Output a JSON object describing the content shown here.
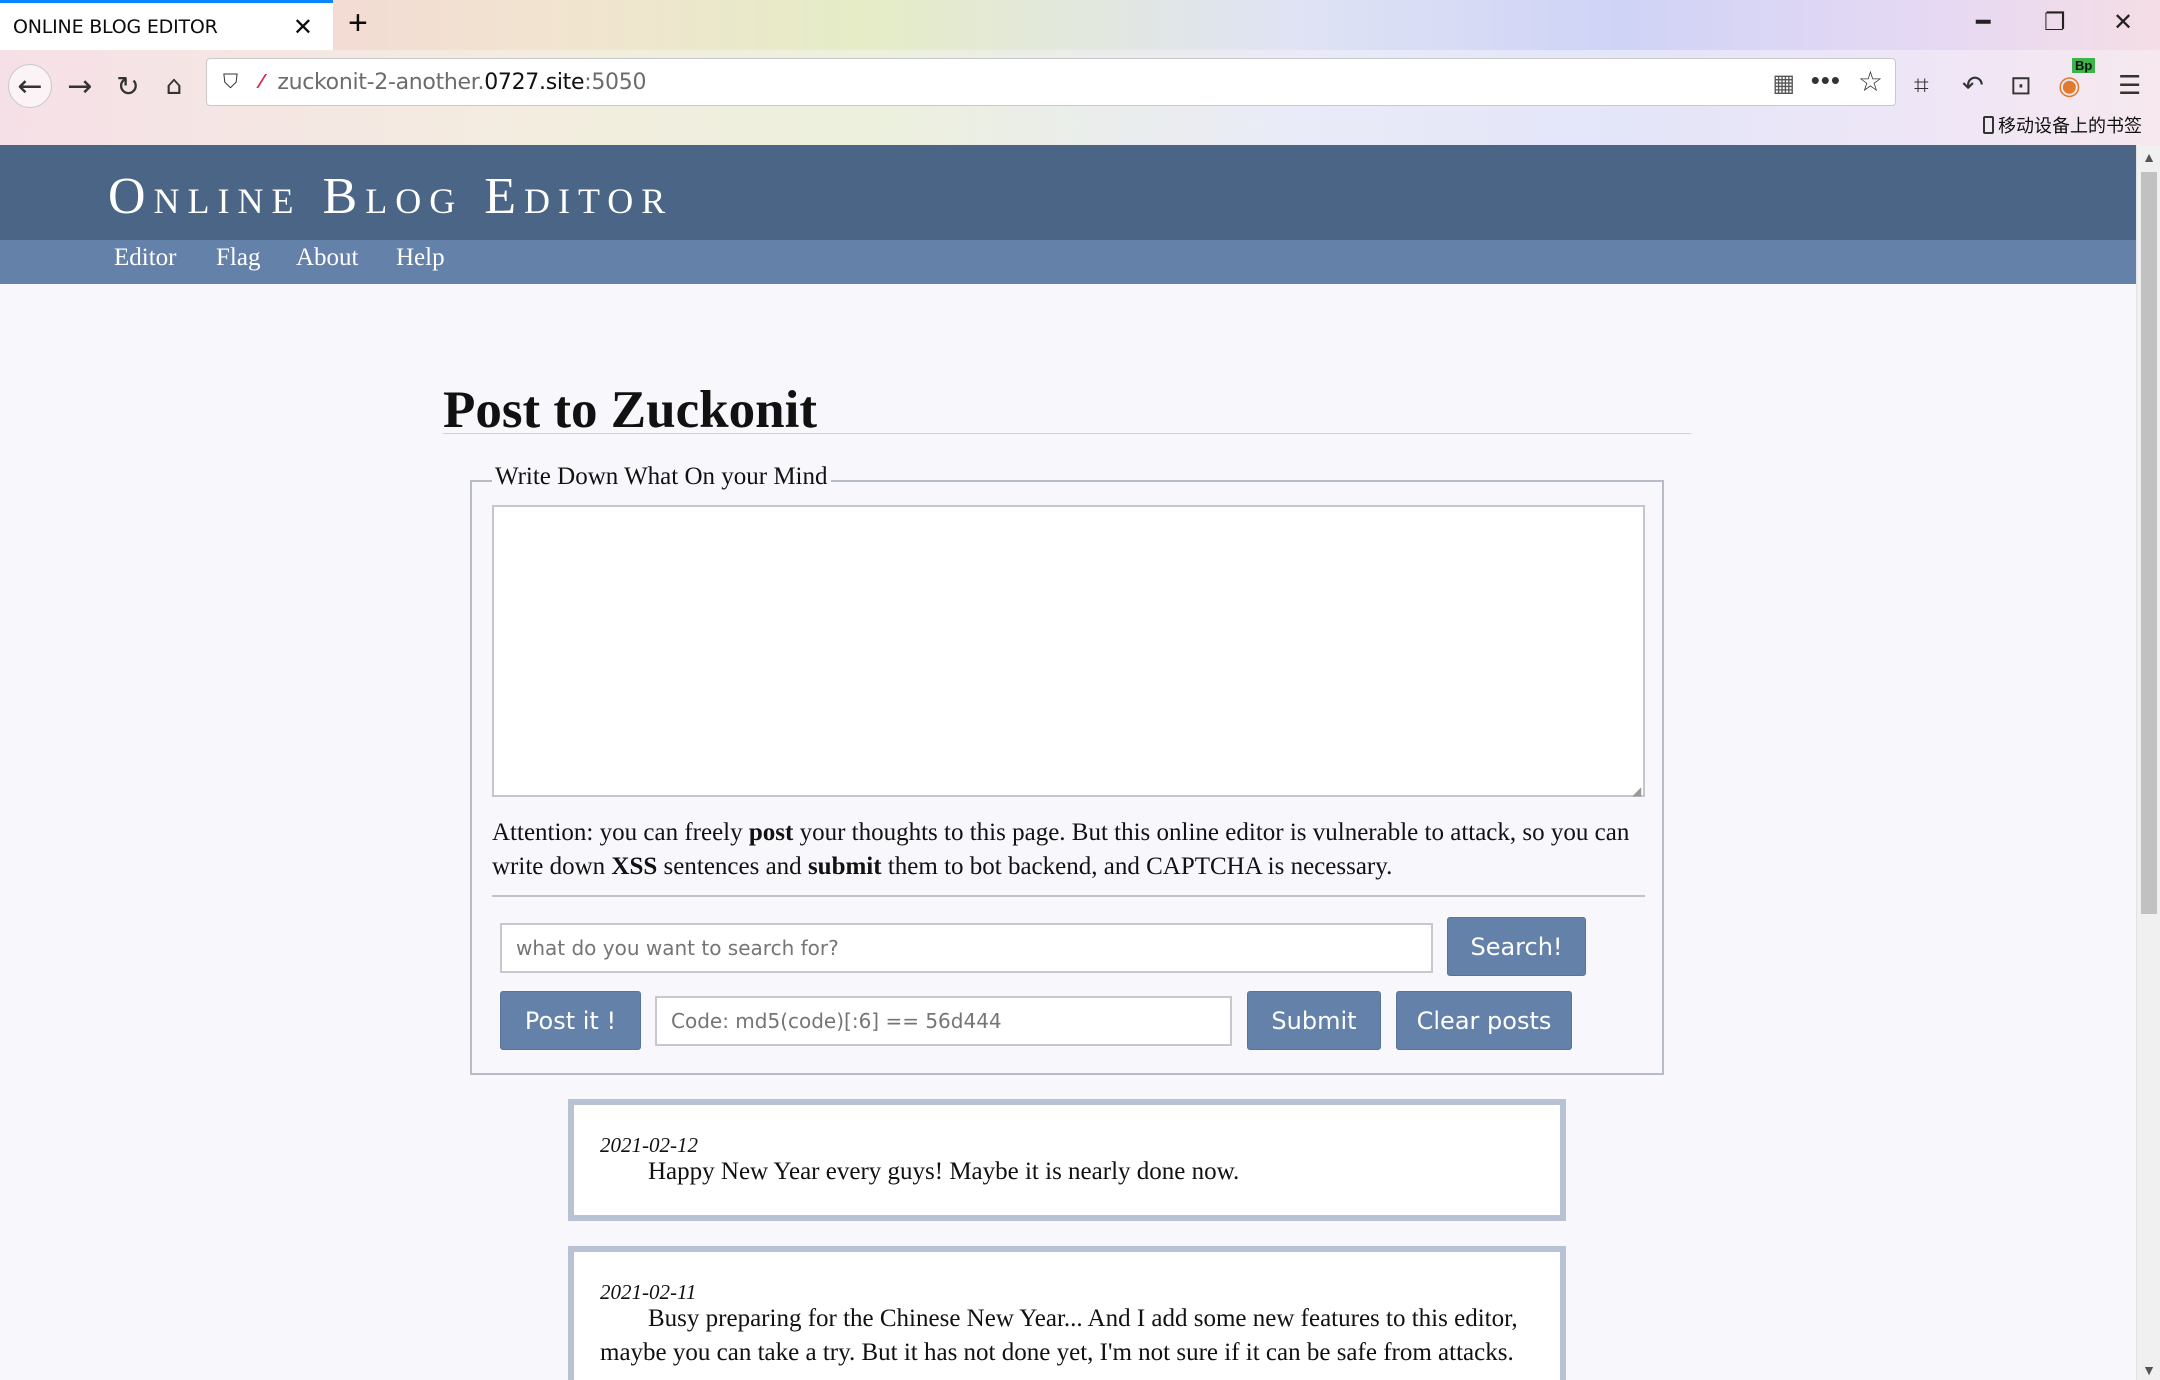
{
  "browser": {
    "tab_title": "ONLINE BLOG EDITOR",
    "url_prefix": "zuckonit-2-another.",
    "url_domain": "0727.site",
    "url_suffix": ":5050",
    "bookmarks_label": "移动设备上的书签",
    "ext_badge": "Bp"
  },
  "site": {
    "title": "Online Blog Editor",
    "menu": [
      "Editor",
      "Flag",
      "About",
      "Help"
    ]
  },
  "main": {
    "heading": "Post to Zuckonit",
    "legend": "Write Down What On your Mind",
    "editor_value": "",
    "attention": {
      "t1": "Attention: you can freely ",
      "b1": "post",
      "t2": " your thoughts to this page. But this online editor is vulnerable to attack, so you can write down ",
      "b2": "XSS",
      "t3": " sentences and ",
      "b3": "submit",
      "t4": " them to bot backend, and CAPTCHA is necessary."
    },
    "search_placeholder": "what do you want to search for?",
    "search_button": "Search!",
    "post_button": "Post it !",
    "code_placeholder": "Code: md5(code)[:6] == 56d444",
    "submit_button": "Submit",
    "clear_button": "Clear posts"
  },
  "posts": [
    {
      "date": "2021-02-12",
      "body": "Happy New Year every guys! Maybe it is nearly done now."
    },
    {
      "date": "2021-02-11",
      "body": "Busy preparing for the Chinese New Year... And I add some new features to this editor, maybe you can take a try. But it has not done yet, I'm not sure if it can be safe from attacks."
    }
  ],
  "colors": {
    "header_bg": "#4a6585",
    "menu_bg": "#6381a9",
    "button_bg": "#6381a9",
    "post_border": "#b9c2d4"
  },
  "icons": [
    "close-icon",
    "new-tab-icon",
    "minimize-icon",
    "restore-icon",
    "window-close-icon",
    "back-icon",
    "forward-icon",
    "reload-icon",
    "home-icon",
    "shield-icon",
    "insecure-lock-icon",
    "qr-code-icon",
    "more-icon",
    "bookmark-star-icon",
    "screenshot-icon",
    "undo-icon",
    "extension-icon",
    "burp-icon",
    "menu-icon",
    "mobile-icon"
  ]
}
